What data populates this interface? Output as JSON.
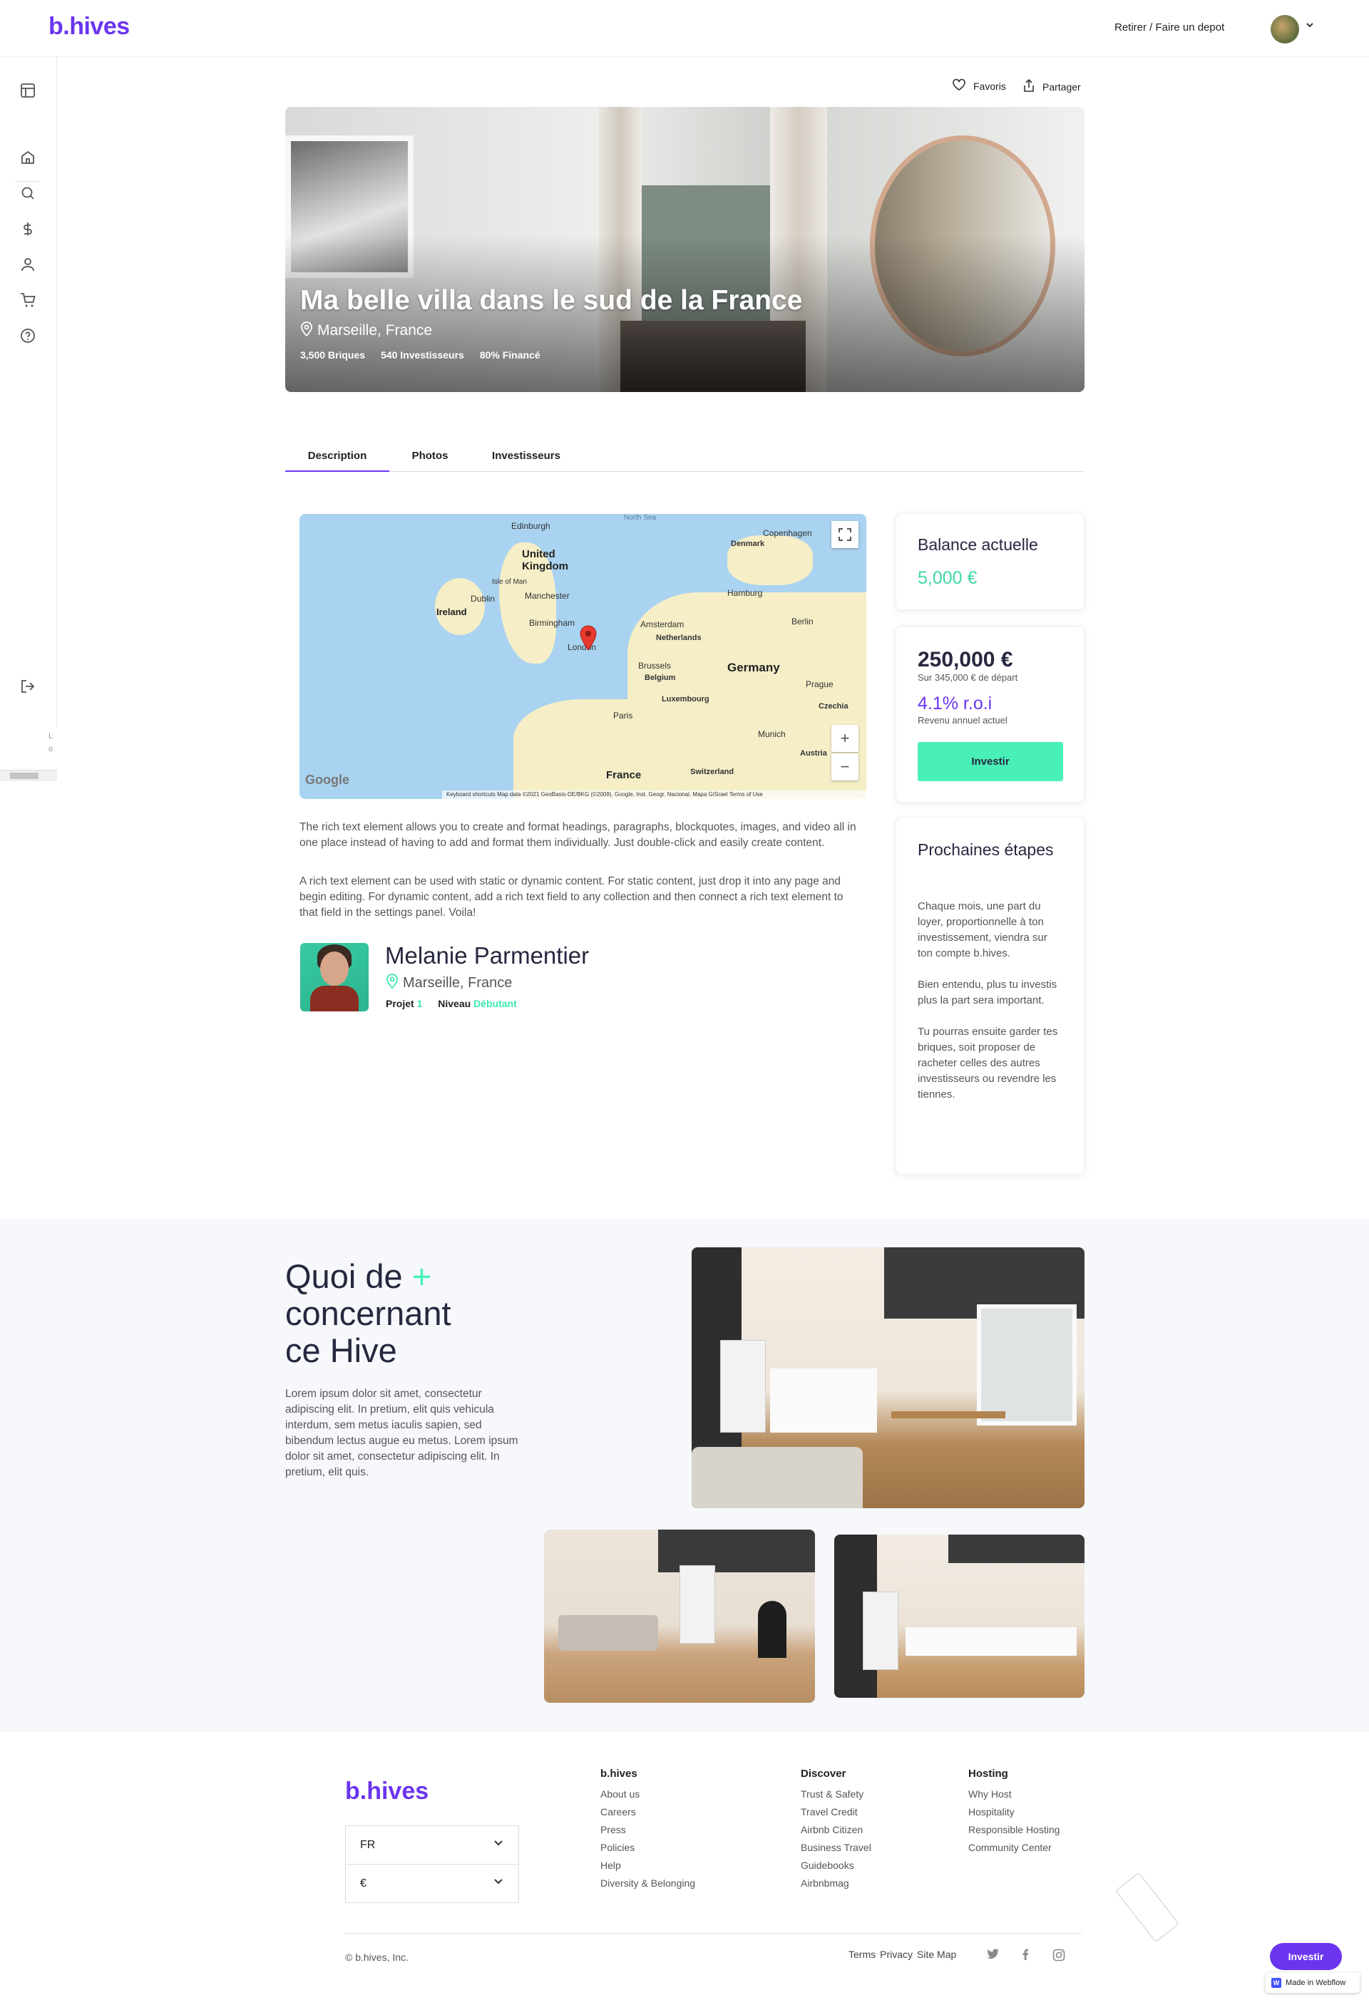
{
  "header": {
    "logo": "b.hives",
    "withdraw_label": "Retirer / Faire un depot"
  },
  "sidebar": {
    "icons": [
      "layout-icon",
      "home-icon",
      "search-icon",
      "dollar-icon",
      "user-icon",
      "cart-icon",
      "help-icon"
    ],
    "logout_icon": "logout-icon",
    "cut_text_1": "L",
    "cut_text_2": "o"
  },
  "actions": {
    "favorites_label": "Favoris",
    "share_label": "Partager"
  },
  "hero": {
    "title": "Ma belle villa dans le sud de la France",
    "location": "Marseille, France",
    "stats": [
      "3,500 Briques",
      "540 Investisseurs",
      "80% Financé"
    ]
  },
  "tabs": [
    "Description",
    "Photos",
    "Investisseurs"
  ],
  "map": {
    "labels": {
      "sea": "North Sea",
      "edinburgh": "Edinburgh",
      "uk": "United\nKingdom",
      "isle": "Isle of Man",
      "dublin": "Dublin",
      "manchester": "Manchester",
      "ireland": "Ireland",
      "birmingham": "Birmingham",
      "london": "London",
      "copenhagen": "Copenhagen",
      "denmark": "Denmark",
      "hamburg": "Hamburg",
      "berlin": "Berlin",
      "amsterdam": "Amsterdam",
      "netherlands": "Netherlands",
      "brussels": "Brussels",
      "belgium": "Belgium",
      "germany": "Germany",
      "prague": "Prague",
      "czechia": "Czechia",
      "luxembourg": "Luxembourg",
      "paris": "Paris",
      "munich": "Munich",
      "austria": "Austria",
      "france": "France",
      "switzerland": "Switzerland"
    },
    "google": "Google",
    "footer": "Keyboard shortcuts   Map data ©2021 GeoBasis-DE/BKG (©2009), Google, Inst. Geogr. Nacional, Mapa GISrael   Terms of Use"
  },
  "description": {
    "p1": "The rich text element allows you to create and format headings, paragraphs, blockquotes, images, and video all in one place instead of having to add and format them individually. Just double-click and easily create content.",
    "p2": "A rich text element can be used with static or dynamic content. For static content, just drop it into any page and begin editing. For dynamic content, add a rich text field to any collection and then connect a rich text element to that field in the settings panel. Voila!"
  },
  "owner": {
    "name": "Melanie Parmentier",
    "location": "Marseille, France",
    "projet_label": "Projet",
    "projet_value": "1",
    "niveau_label": "Niveau",
    "niveau_value": "Débutant"
  },
  "balance": {
    "title": "Balance actuelle",
    "value": "5,000 €"
  },
  "invest_card": {
    "amount": "250,000 €",
    "sub": "Sur 345,000 € de départ",
    "roi": "4.1% r.o.i",
    "roi_sub": "Revenu annuel actuel",
    "button": "Investir"
  },
  "steps": {
    "title": "Prochaines étapes",
    "p1": "Chaque mois, une part du loyer, proportionnelle à ton investissement, viendra sur ton compte b.hives.",
    "p2": "Bien entendu, plus tu investis plus la part sera important.",
    "p3": "Tu pourras ensuite garder tes briques, soit proposer de racheter celles des autres investisseurs ou revendre les tiennes."
  },
  "about": {
    "title_1": "Quoi de ",
    "title_plus": "+",
    "title_2": "concernant",
    "title_3": "ce Hive",
    "body": "Lorem ipsum dolor sit amet, consectetur adipiscing elit. In pretium, elit quis vehicula interdum, sem metus iaculis sapien, sed bibendum lectus augue eu metus. Lorem ipsum dolor sit amet, consectetur adipiscing elit. In pretium, elit quis."
  },
  "footer": {
    "logo": "b.hives",
    "lang": "FR",
    "currency": "€",
    "col1": {
      "title": "b.hives",
      "links": [
        "About us",
        "Careers",
        "Press",
        "Policies",
        "Help",
        "Diversity & Belonging"
      ]
    },
    "col2": {
      "title": "Discover",
      "links": [
        "Trust & Safety",
        "Travel Credit",
        "Airbnb Citizen",
        "Business Travel",
        "Guidebooks",
        "Airbnbmag"
      ]
    },
    "col3": {
      "title": "Hosting",
      "links": [
        "Why Host",
        "Hospitality",
        "Responsible Hosting",
        "Community Center"
      ]
    },
    "copyright": "© b.hives, Inc.",
    "terms": "Terms",
    "privacy": "Privacy",
    "sitemap": "Site Map",
    "float_invest": "Investir",
    "webflow": "Made in Webflow"
  },
  "colors": {
    "brand": "#6b35f0",
    "accent": "#48f0b7"
  }
}
